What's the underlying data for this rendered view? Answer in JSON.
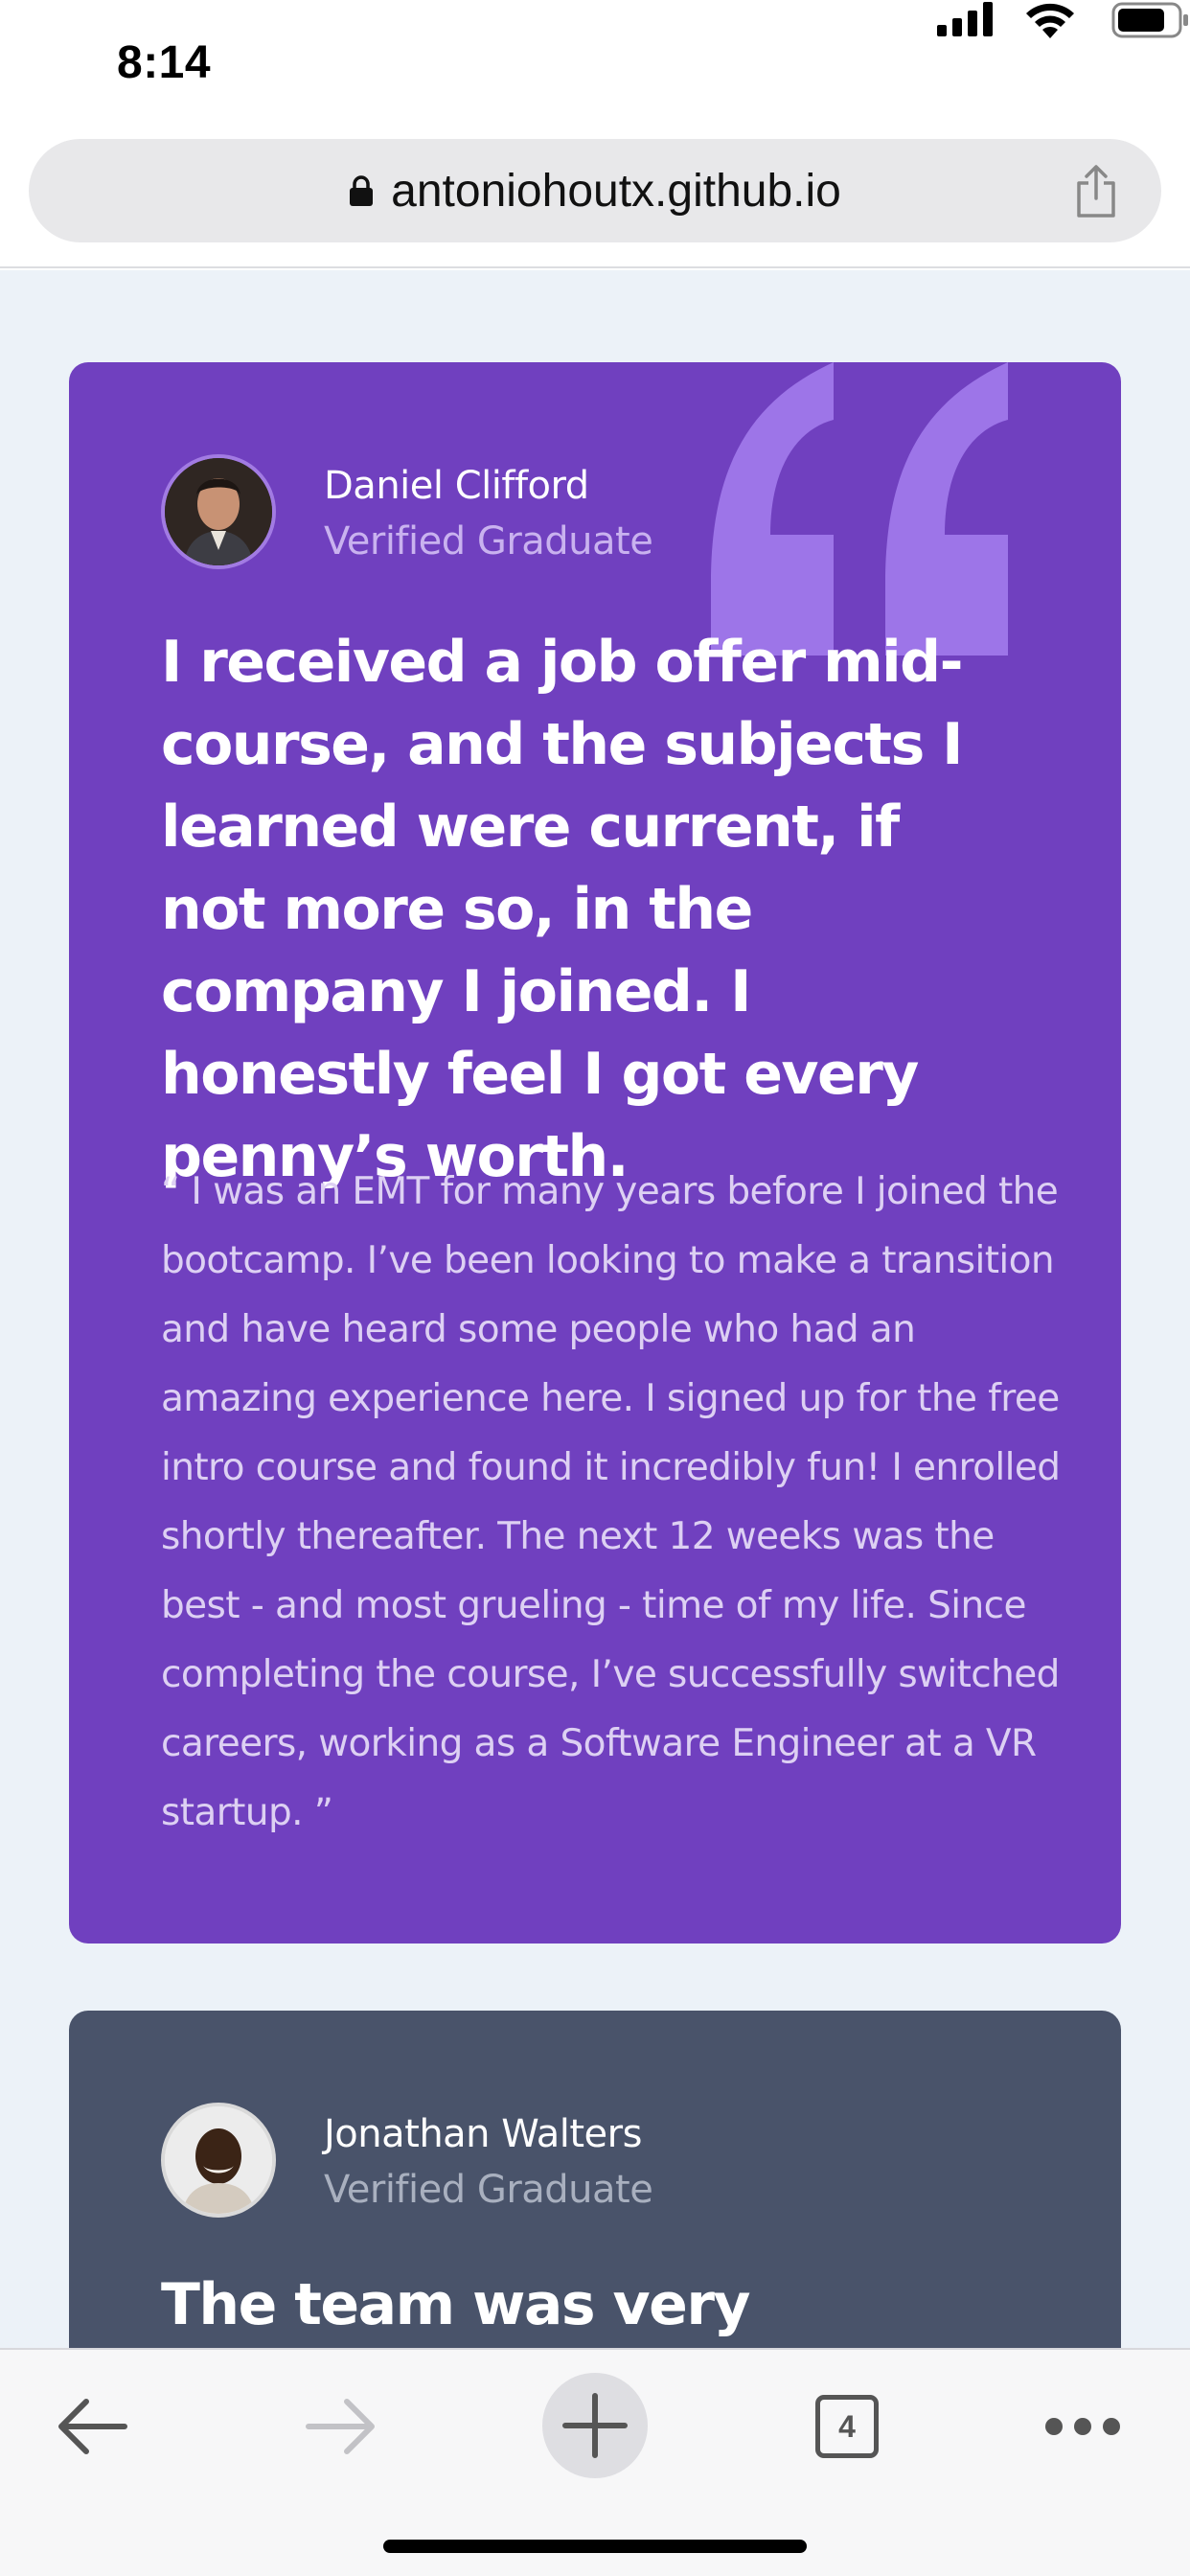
{
  "status_bar": {
    "time": "8:14"
  },
  "browser": {
    "url": "antoniohoutx.github.io",
    "tab_count": "4"
  },
  "testimonials": [
    {
      "name": "Daniel Clifford",
      "role": "Verified Graduate",
      "headline": "I received a job offer mid-course, and the subjects I learned were current, if not more so, in the company I joined. I honestly feel I got every penny’s worth.",
      "body": "“ I was an EMT for many years before I joined the bootcamp. I’ve been looking to make a transition and have heard some people who had an amazing experience here. I signed up for the free intro course and found it incredibly fun! I enrolled shortly thereafter. The next 12 weeks was the best - and most grueling - time of my life. Since completing the course, I’ve successfully switched careers, working as a Software Engineer at a VR startup. ”",
      "color": "#7040bf"
    },
    {
      "name": "Jonathan Walters",
      "role": "Verified Graduate",
      "headline": "The team was very supportive",
      "color": "#49536a"
    }
  ],
  "icons": {
    "status": [
      "signal-icon",
      "wifi-icon",
      "battery-icon"
    ],
    "url_bar": [
      "lock-icon",
      "share-icon"
    ],
    "toolbar": [
      "back-arrow-icon",
      "forward-arrow-icon",
      "plus-icon",
      "tabs-icon",
      "more-icon"
    ],
    "decor": [
      "quotation-mark-icon"
    ]
  }
}
